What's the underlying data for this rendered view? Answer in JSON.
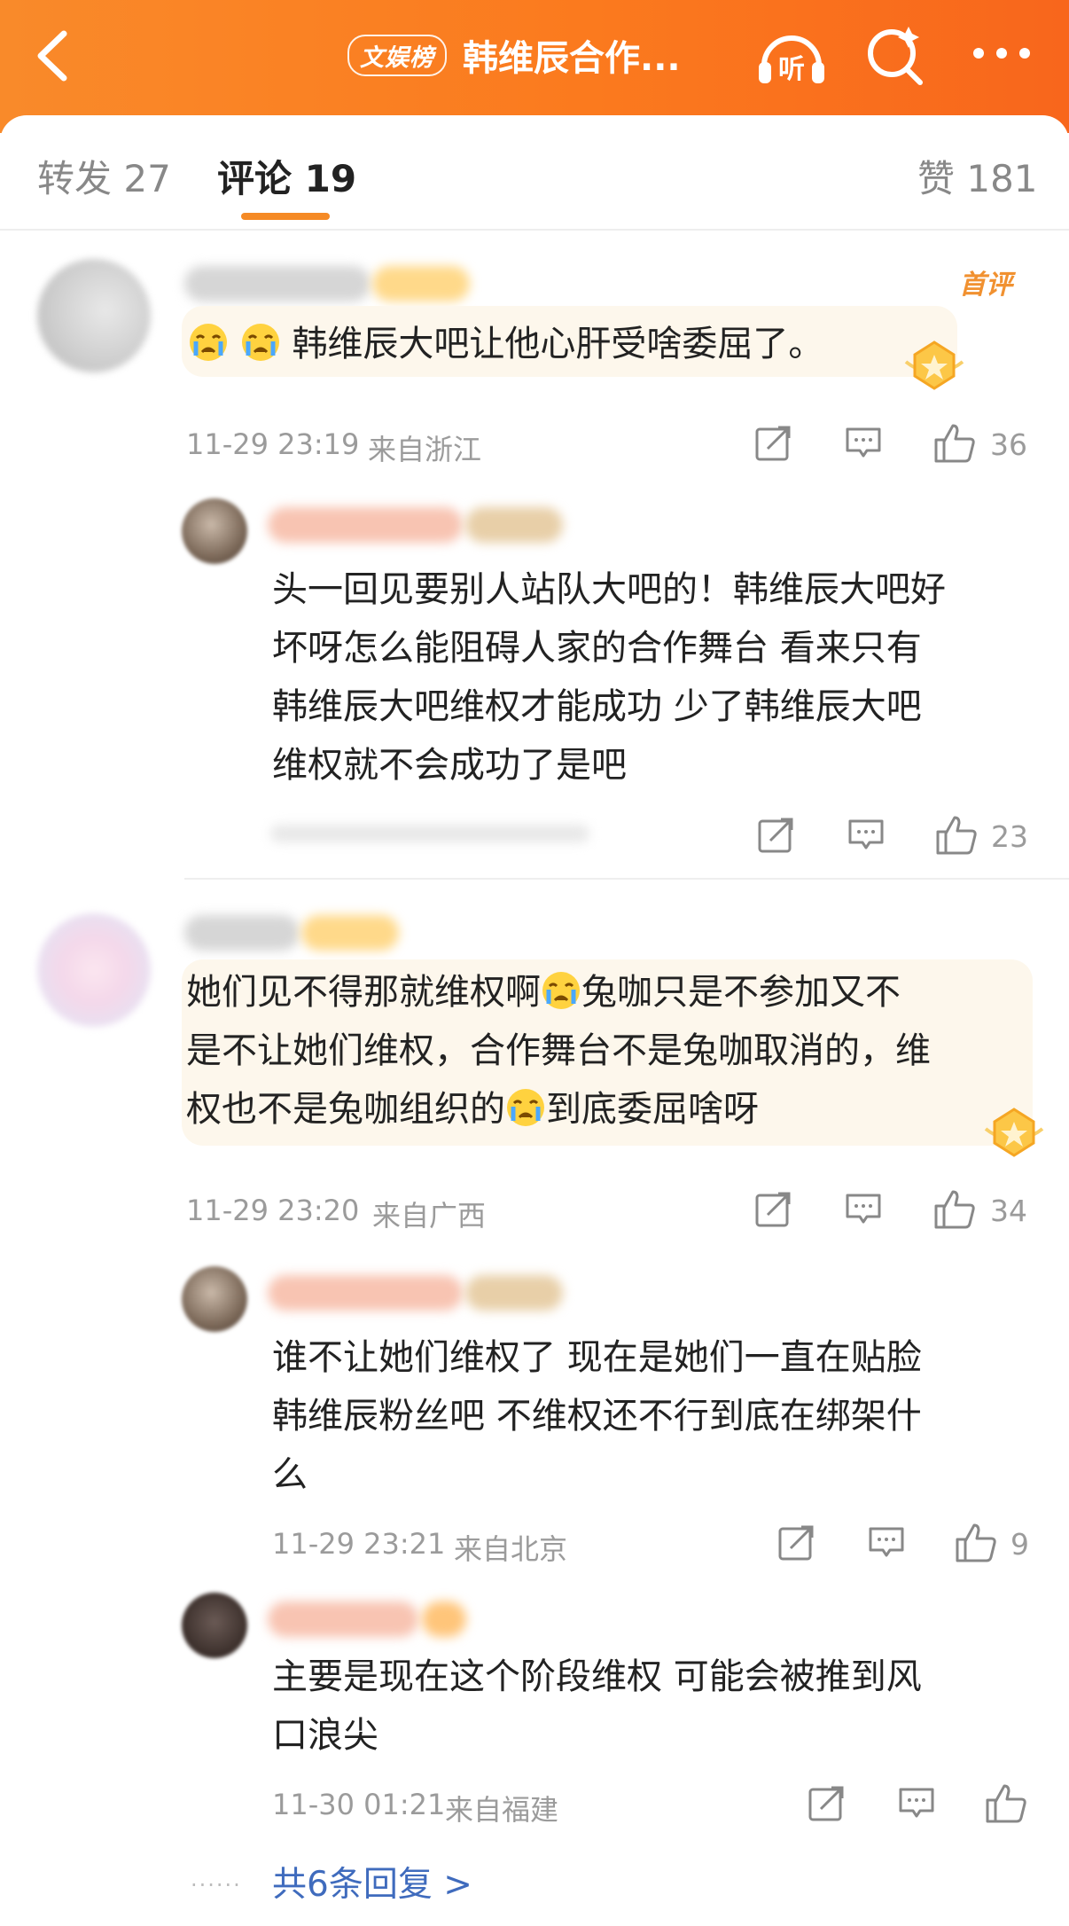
{
  "header": {
    "brand_label": "文娱榜",
    "title": "韩维辰合作...",
    "listen_label": "听"
  },
  "tabs": {
    "repost": "转发 27",
    "comments": "评论 19",
    "likes": "赞 181"
  },
  "comments": [
    {
      "badge": "首评",
      "text": "韩维辰大吧让他心肝受啥委屈了。",
      "time": "11-29 23:19",
      "location": "来自浙江",
      "likes": "36",
      "replies": [
        {
          "text_lines": [
            "头一回见要别人站队大吧的！韩维辰大吧好",
            "坏呀怎么能阻碍人家的合作舞台 看来只有",
            "韩维辰大吧维权才能成功 少了韩维辰大吧",
            "维权就不会成功了是吧"
          ],
          "likes": "23"
        }
      ]
    },
    {
      "text_lines_a": "她们见不得那就维权啊",
      "text_lines_b": "兔咖只是不参加又不",
      "text_line2": "是不让她们维权，合作舞台不是兔咖取消的，维",
      "text_line3_a": "权也不是兔咖组织的",
      "text_line3_b": "到底委屈啥呀",
      "time": "11-29 23:20",
      "location": "来自广西",
      "likes": "34",
      "replies": [
        {
          "text_lines": [
            "谁不让她们维权了 现在是她们一直在贴脸",
            "韩维辰粉丝吧 不维权还不行到底在绑架什",
            "么"
          ],
          "time": "11-29 23:21",
          "location": "来自北京",
          "likes": "9"
        },
        {
          "text_lines": [
            "主要是现在这个阶段维权 可能会被推到风",
            "口浪尖"
          ],
          "time": "11-30 01:21",
          "location": "来自福建"
        }
      ],
      "more_replies": "共6条回复 >"
    }
  ],
  "colors": {
    "header_start": "#f98a2a",
    "header_end": "#f8661c",
    "accent": "#f58a25",
    "link": "#3f6bbd"
  }
}
